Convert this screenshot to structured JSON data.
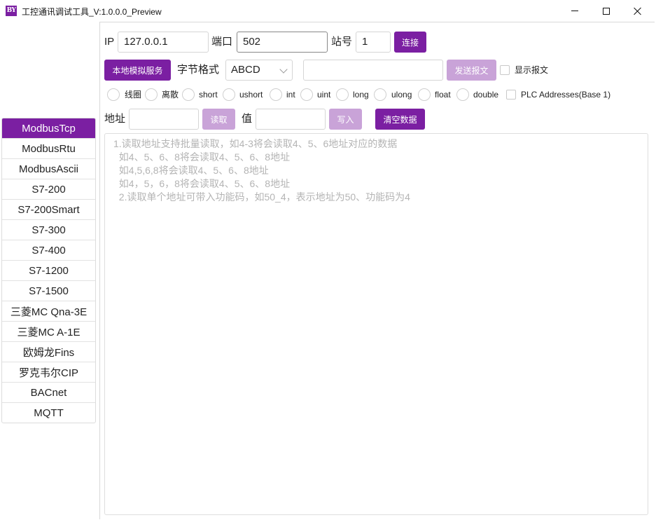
{
  "window": {
    "logo_text": "BY",
    "title": "工控通讯调试工具_V:1.0.0.0_Preview"
  },
  "nav": {
    "items": [
      {
        "label": "ModbusTcp",
        "active": true
      },
      {
        "label": "ModbusRtu"
      },
      {
        "label": "ModbusAscii"
      },
      {
        "label": "S7-200"
      },
      {
        "label": "S7-200Smart"
      },
      {
        "label": "S7-300"
      },
      {
        "label": "S7-400"
      },
      {
        "label": "S7-1200"
      },
      {
        "label": "S7-1500"
      },
      {
        "label": "三菱MC Qna-3E"
      },
      {
        "label": "三菱MC A-1E"
      },
      {
        "label": "欧姆龙Fins"
      },
      {
        "label": "罗克韦尔CIP"
      },
      {
        "label": "BACnet"
      },
      {
        "label": "MQTT"
      }
    ]
  },
  "connection": {
    "ip_label": "IP",
    "ip_value": "127.0.0.1",
    "port_label": "端口",
    "port_value": "502",
    "station_label": "站号",
    "station_value": "1",
    "connect_button": "连接"
  },
  "options": {
    "local_sim_button": "本地模拟服务",
    "byte_format_label": "字节格式",
    "byte_format_value": "ABCD",
    "message_value": "",
    "send_button": "发送报文",
    "show_message_label": "显示报文"
  },
  "data_types": [
    "线圈",
    "离散",
    "short",
    "ushort",
    "int",
    "uint",
    "long",
    "ulong",
    "float",
    "double"
  ],
  "plc_addresses_label": "PLC Addresses(Base 1)",
  "read_write": {
    "address_label": "地址",
    "address_value": "",
    "read_button": "读取",
    "value_label": "值",
    "value_value": "",
    "write_button": "写入",
    "clear_button": "清空数据"
  },
  "log": {
    "lines": [
      "1.读取地址支持批量读取，如4-3将会读取4、5、6地址对应的数据",
      "  如4、5、6、8将会读取4、5、6、8地址",
      "  如4,5,6,8将会读取4、5、6、8地址",
      "  如4，5，6，8将会读取4、5、6、8地址",
      "  2.读取单个地址可带入功能码，如50_4，表示地址为50、功能码为4"
    ]
  },
  "colors": {
    "accent": "#7b1fa2",
    "accent_disabled": "#c9a3d8",
    "hint_text": "#b4b4b4"
  }
}
